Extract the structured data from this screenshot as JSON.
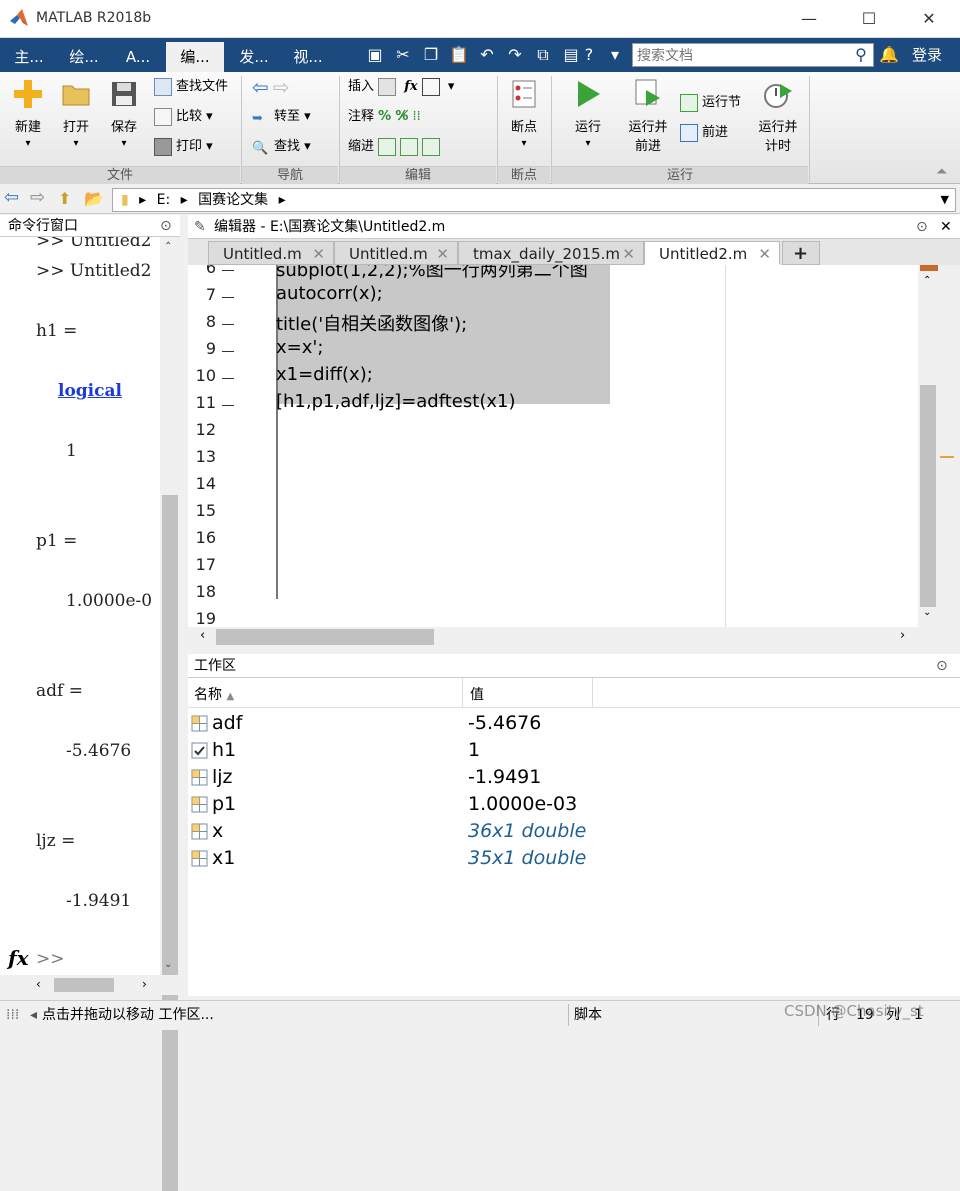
{
  "window": {
    "title": "MATLAB R2018b",
    "min": "—",
    "max": "☐",
    "close": "✕"
  },
  "tabs": [
    {
      "label": "主..."
    },
    {
      "label": "绘..."
    },
    {
      "label": "A..."
    },
    {
      "label": "编..."
    },
    {
      "label": "发..."
    },
    {
      "label": "视..."
    }
  ],
  "search": {
    "placeholder": "搜索文档"
  },
  "login": "登录",
  "ribbon": {
    "file": {
      "new": "新建",
      "open": "打开",
      "save": "保存",
      "find_files": "查找文件",
      "compare": "比较",
      "print": "打印",
      "group": "文件"
    },
    "nav": {
      "goto": "转至",
      "find": "查找",
      "group": "导航"
    },
    "edit": {
      "insert": "插入",
      "comment": "注释",
      "indent": "缩进",
      "fx": "fx",
      "group": "编辑"
    },
    "breakpoints": {
      "label": "断点",
      "group": "断点"
    },
    "run": {
      "run": "运行",
      "run_advance_1": "运行并",
      "run_advance_2": "前进",
      "run_section": "运行节",
      "advance": "前进",
      "run_time_1": "运行并",
      "run_time_2": "计时",
      "group": "运行"
    }
  },
  "address": {
    "drive": "E:",
    "folder": "国赛论文集"
  },
  "command_window": {
    "title": "命令行窗口",
    "lines": [
      ">> Untitled2",
      ">> Untitled2",
      "h1 =",
      "logical",
      "1",
      "p1 =",
      "1.0000e-0",
      "adf =",
      "-5.4676",
      "ljz =",
      "-1.9491"
    ],
    "prompt": ">>",
    "fx": "fx"
  },
  "editor": {
    "title": "编辑器 - E:\\国赛论文集\\Untitled2.m",
    "tabs": [
      "Untitled.m",
      "Untitled.m",
      "tmax_daily_2015.m",
      "Untitled2.m"
    ],
    "add_tab": "+",
    "lines": [
      {
        "n": "6",
        "code": "subplot(1,2,2);%图一行两列第二个图"
      },
      {
        "n": "7",
        "code": "autocorr(x);"
      },
      {
        "n": "8",
        "code": "title('自相关函数图像');"
      },
      {
        "n": "9",
        "code": "x=x';"
      },
      {
        "n": "10",
        "code": "x1=diff(x);"
      },
      {
        "n": "11",
        "code": "[h1,p1,adf,ljz]=adftest(x1)"
      },
      {
        "n": "12",
        "code": ""
      },
      {
        "n": "13",
        "code": ""
      },
      {
        "n": "14",
        "code": ""
      },
      {
        "n": "15",
        "code": ""
      },
      {
        "n": "16",
        "code": ""
      },
      {
        "n": "17",
        "code": ""
      },
      {
        "n": "18",
        "code": ""
      },
      {
        "n": "19",
        "code": ""
      }
    ]
  },
  "workspace": {
    "title": "工作区",
    "col_name": "名称",
    "col_value": "值",
    "rows": [
      {
        "name": "adf",
        "value": "-5.4676"
      },
      {
        "name": "h1",
        "value": "1"
      },
      {
        "name": "ljz",
        "value": "-1.9491"
      },
      {
        "name": "p1",
        "value": "1.0000e-03"
      },
      {
        "name": "x",
        "value": "36x1 double"
      },
      {
        "name": "x1",
        "value": "35x1 double"
      }
    ]
  },
  "status": {
    "message": "点击并拖动以移动 工作区...",
    "mode": "脚本",
    "row_label": "行",
    "row": "19",
    "col_label": "列",
    "col": "1",
    "watermark": "CSDN @Chasity_st"
  },
  "colors": {
    "tabbar": "#1c4a7e",
    "accent_orange": "#e8a33c",
    "double_blue": "#1f5f94"
  }
}
